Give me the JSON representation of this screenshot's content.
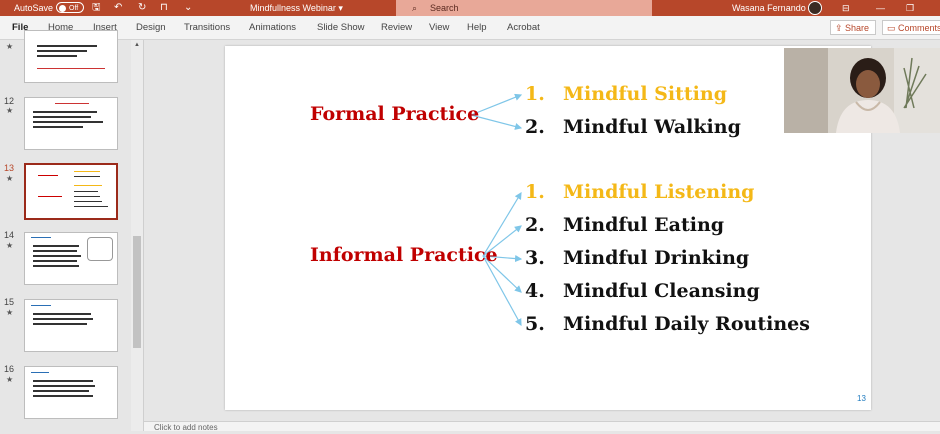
{
  "titlebar": {
    "autosave_label": "AutoSave",
    "autosave_state": "Off",
    "doc_title": "Mindfullness Webinar",
    "doc_title_caret": "▾",
    "search_placeholder": "Search",
    "user_name": "Wasana Fernando",
    "accent_color": "#b7472a"
  },
  "ribbon": {
    "tabs": [
      "File",
      "Home",
      "Insert",
      "Design",
      "Transitions",
      "Animations",
      "Slide Show",
      "Review",
      "View",
      "Help",
      "Acrobat"
    ],
    "share_label": "Share",
    "comments_label": "Comments"
  },
  "thumbnails": [
    {
      "number": "",
      "star": "★"
    },
    {
      "number": "12",
      "star": "★"
    },
    {
      "number": "13",
      "star": "★"
    },
    {
      "number": "14",
      "star": "★"
    },
    {
      "number": "15",
      "star": "★"
    },
    {
      "number": "16",
      "star": "★"
    }
  ],
  "slide": {
    "formal_label": "Formal Practice",
    "informal_label": "Informal Practice",
    "formal_items": [
      {
        "num": "1.",
        "text": "Mindful Sitting"
      },
      {
        "num": "2.",
        "text": "Mindful Walking"
      }
    ],
    "informal_items": [
      {
        "num": "1.",
        "text": "Mindful Listening"
      },
      {
        "num": "2.",
        "text": "Mindful Eating"
      },
      {
        "num": "3.",
        "text": "Mindful Drinking"
      },
      {
        "num": "4.",
        "text": "Mindful Cleansing"
      },
      {
        "num": "5.",
        "text": "Mindful Daily Routines"
      }
    ],
    "page_number": "13",
    "label_color": "#c00000",
    "highlight_color": "#f4b817",
    "arrow_color": "#7fc6e8"
  },
  "notes": {
    "placeholder": "Click to add notes"
  }
}
